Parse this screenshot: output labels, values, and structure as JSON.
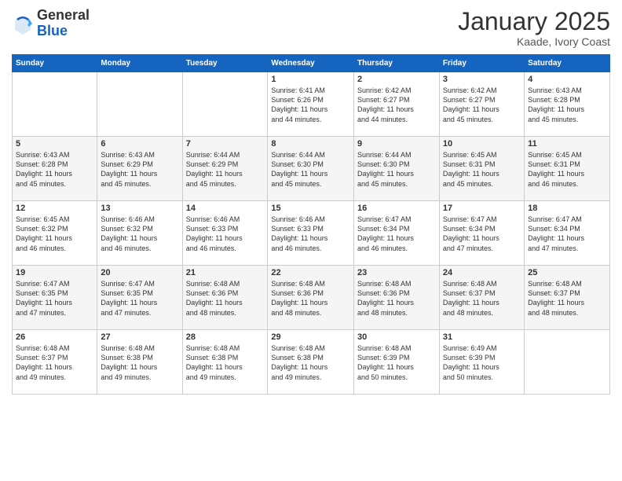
{
  "header": {
    "logo_general": "General",
    "logo_blue": "Blue",
    "month_title": "January 2025",
    "location": "Kaade, Ivory Coast"
  },
  "weekdays": [
    "Sunday",
    "Monday",
    "Tuesday",
    "Wednesday",
    "Thursday",
    "Friday",
    "Saturday"
  ],
  "weeks": [
    [
      {
        "day": "",
        "info": ""
      },
      {
        "day": "",
        "info": ""
      },
      {
        "day": "",
        "info": ""
      },
      {
        "day": "1",
        "info": "Sunrise: 6:41 AM\nSunset: 6:26 PM\nDaylight: 11 hours\nand 44 minutes."
      },
      {
        "day": "2",
        "info": "Sunrise: 6:42 AM\nSunset: 6:27 PM\nDaylight: 11 hours\nand 44 minutes."
      },
      {
        "day": "3",
        "info": "Sunrise: 6:42 AM\nSunset: 6:27 PM\nDaylight: 11 hours\nand 45 minutes."
      },
      {
        "day": "4",
        "info": "Sunrise: 6:43 AM\nSunset: 6:28 PM\nDaylight: 11 hours\nand 45 minutes."
      }
    ],
    [
      {
        "day": "5",
        "info": "Sunrise: 6:43 AM\nSunset: 6:28 PM\nDaylight: 11 hours\nand 45 minutes."
      },
      {
        "day": "6",
        "info": "Sunrise: 6:43 AM\nSunset: 6:29 PM\nDaylight: 11 hours\nand 45 minutes."
      },
      {
        "day": "7",
        "info": "Sunrise: 6:44 AM\nSunset: 6:29 PM\nDaylight: 11 hours\nand 45 minutes."
      },
      {
        "day": "8",
        "info": "Sunrise: 6:44 AM\nSunset: 6:30 PM\nDaylight: 11 hours\nand 45 minutes."
      },
      {
        "day": "9",
        "info": "Sunrise: 6:44 AM\nSunset: 6:30 PM\nDaylight: 11 hours\nand 45 minutes."
      },
      {
        "day": "10",
        "info": "Sunrise: 6:45 AM\nSunset: 6:31 PM\nDaylight: 11 hours\nand 45 minutes."
      },
      {
        "day": "11",
        "info": "Sunrise: 6:45 AM\nSunset: 6:31 PM\nDaylight: 11 hours\nand 46 minutes."
      }
    ],
    [
      {
        "day": "12",
        "info": "Sunrise: 6:45 AM\nSunset: 6:32 PM\nDaylight: 11 hours\nand 46 minutes."
      },
      {
        "day": "13",
        "info": "Sunrise: 6:46 AM\nSunset: 6:32 PM\nDaylight: 11 hours\nand 46 minutes."
      },
      {
        "day": "14",
        "info": "Sunrise: 6:46 AM\nSunset: 6:33 PM\nDaylight: 11 hours\nand 46 minutes."
      },
      {
        "day": "15",
        "info": "Sunrise: 6:46 AM\nSunset: 6:33 PM\nDaylight: 11 hours\nand 46 minutes."
      },
      {
        "day": "16",
        "info": "Sunrise: 6:47 AM\nSunset: 6:34 PM\nDaylight: 11 hours\nand 46 minutes."
      },
      {
        "day": "17",
        "info": "Sunrise: 6:47 AM\nSunset: 6:34 PM\nDaylight: 11 hours\nand 47 minutes."
      },
      {
        "day": "18",
        "info": "Sunrise: 6:47 AM\nSunset: 6:34 PM\nDaylight: 11 hours\nand 47 minutes."
      }
    ],
    [
      {
        "day": "19",
        "info": "Sunrise: 6:47 AM\nSunset: 6:35 PM\nDaylight: 11 hours\nand 47 minutes."
      },
      {
        "day": "20",
        "info": "Sunrise: 6:47 AM\nSunset: 6:35 PM\nDaylight: 11 hours\nand 47 minutes."
      },
      {
        "day": "21",
        "info": "Sunrise: 6:48 AM\nSunset: 6:36 PM\nDaylight: 11 hours\nand 48 minutes."
      },
      {
        "day": "22",
        "info": "Sunrise: 6:48 AM\nSunset: 6:36 PM\nDaylight: 11 hours\nand 48 minutes."
      },
      {
        "day": "23",
        "info": "Sunrise: 6:48 AM\nSunset: 6:36 PM\nDaylight: 11 hours\nand 48 minutes."
      },
      {
        "day": "24",
        "info": "Sunrise: 6:48 AM\nSunset: 6:37 PM\nDaylight: 11 hours\nand 48 minutes."
      },
      {
        "day": "25",
        "info": "Sunrise: 6:48 AM\nSunset: 6:37 PM\nDaylight: 11 hours\nand 48 minutes."
      }
    ],
    [
      {
        "day": "26",
        "info": "Sunrise: 6:48 AM\nSunset: 6:37 PM\nDaylight: 11 hours\nand 49 minutes."
      },
      {
        "day": "27",
        "info": "Sunrise: 6:48 AM\nSunset: 6:38 PM\nDaylight: 11 hours\nand 49 minutes."
      },
      {
        "day": "28",
        "info": "Sunrise: 6:48 AM\nSunset: 6:38 PM\nDaylight: 11 hours\nand 49 minutes."
      },
      {
        "day": "29",
        "info": "Sunrise: 6:48 AM\nSunset: 6:38 PM\nDaylight: 11 hours\nand 49 minutes."
      },
      {
        "day": "30",
        "info": "Sunrise: 6:48 AM\nSunset: 6:39 PM\nDaylight: 11 hours\nand 50 minutes."
      },
      {
        "day": "31",
        "info": "Sunrise: 6:49 AM\nSunset: 6:39 PM\nDaylight: 11 hours\nand 50 minutes."
      },
      {
        "day": "",
        "info": ""
      }
    ]
  ]
}
